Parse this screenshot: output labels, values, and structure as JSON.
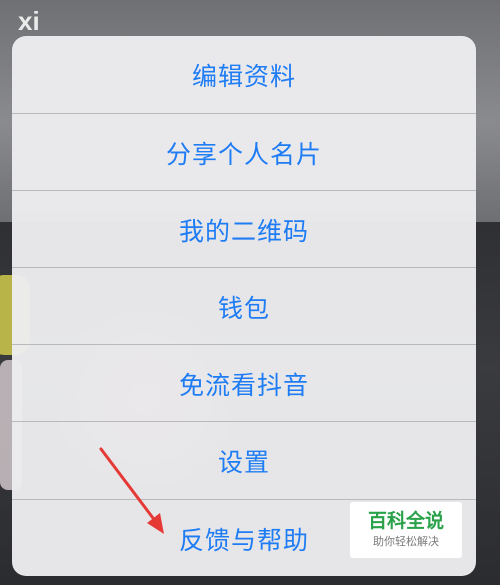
{
  "background": {
    "corner_text": "xi"
  },
  "menu": {
    "items": [
      {
        "label": "编辑资料"
      },
      {
        "label": "分享个人名片"
      },
      {
        "label": "我的二维码"
      },
      {
        "label": "钱包"
      },
      {
        "label": "免流看抖音"
      },
      {
        "label": "设置"
      },
      {
        "label": "反馈与帮助"
      }
    ],
    "text_color": "#1e7cf5"
  },
  "annotation": {
    "color": "#e53935",
    "points_to": "反馈与帮助"
  },
  "watermark": {
    "title": "百科全说",
    "subtitle": "助你轻松解决"
  }
}
